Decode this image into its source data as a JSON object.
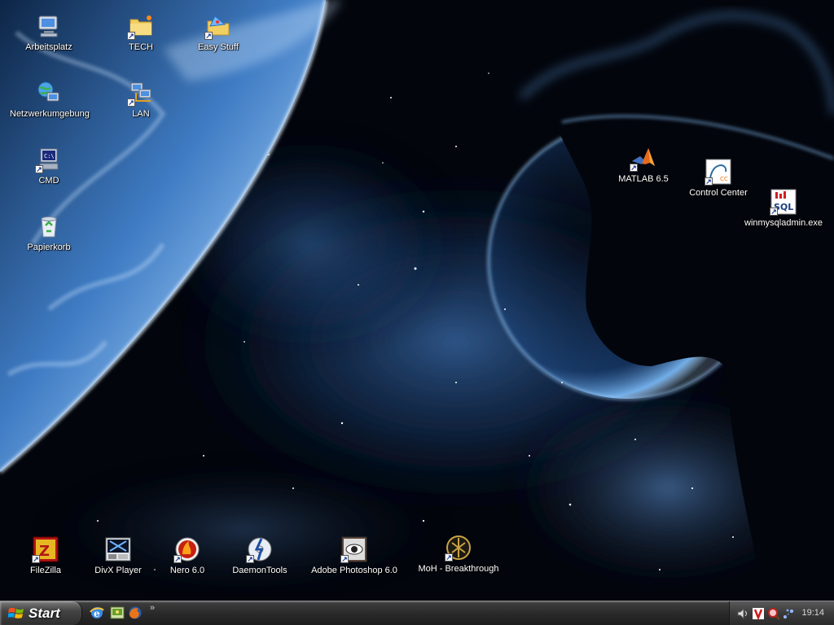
{
  "desktop": {
    "icons": [
      {
        "label": "Arbeitsplatz",
        "icon": "my-computer-icon"
      },
      {
        "label": "TECH",
        "icon": "folder-icon"
      },
      {
        "label": "Easy Stuff",
        "icon": "shared-folder-icon"
      },
      {
        "label": "Netzwerkumgebung",
        "icon": "network-places-icon"
      },
      {
        "label": "LAN",
        "icon": "lan-connection-icon"
      },
      {
        "label": "CMD",
        "icon": "command-prompt-icon"
      },
      {
        "label": "Papierkorb",
        "icon": "recycle-bin-icon"
      },
      {
        "label": "MATLAB 6.5",
        "icon": "matlab-icon"
      },
      {
        "label": "Control Center",
        "icon": "mysql-control-center-icon"
      },
      {
        "label": "winmysqladmin.exe",
        "icon": "mysql-admin-icon"
      },
      {
        "label": "FileZilla",
        "icon": "filezilla-icon"
      },
      {
        "label": "DivX Player",
        "icon": "divx-player-icon"
      },
      {
        "label": "Nero 6.0",
        "icon": "nero-icon"
      },
      {
        "label": "DaemonTools",
        "icon": "daemon-tools-icon"
      },
      {
        "label": "Adobe Photoshop 6.0",
        "icon": "photoshop-icon"
      },
      {
        "label": "MoH - Breakthrough",
        "icon": "moh-breakthrough-icon"
      }
    ]
  },
  "taskbar": {
    "start_label": "Start",
    "quick_launch": [
      "internet-explorer-icon",
      "show-desktop-icon",
      "firefox-icon"
    ],
    "chevron": "»",
    "tray_icons": [
      "volume-icon",
      "antivirus-icon",
      "search-icon",
      "network-icon"
    ],
    "clock": "19:14"
  },
  "colors": {
    "space_background": "#02050c",
    "nebula_blue": "#1f4f8f",
    "glow_blue": "#6fb4ff",
    "taskbar_dark": "#2a2a2a"
  }
}
